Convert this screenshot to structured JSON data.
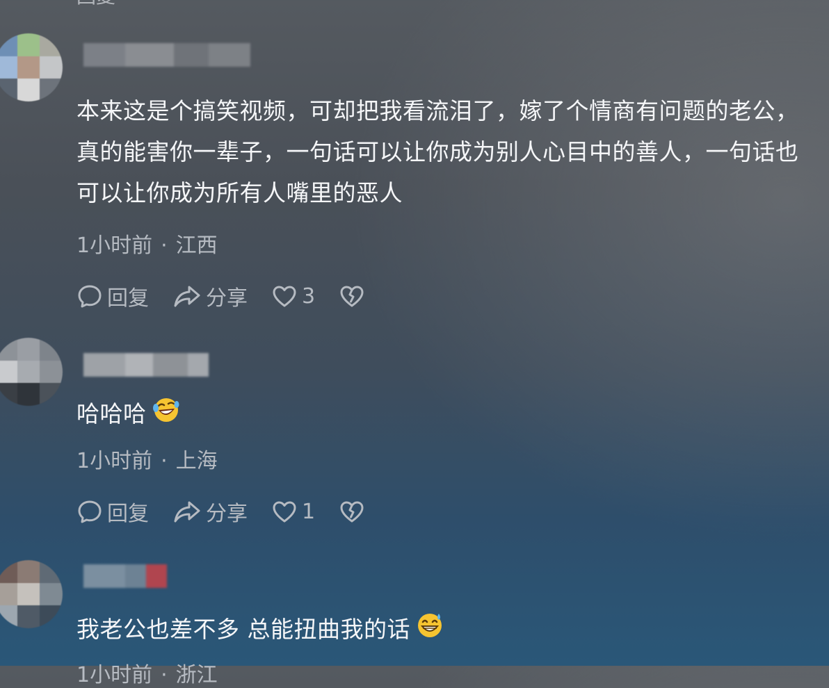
{
  "top_partial": "回复",
  "comments": [
    {
      "text": "本来这是个搞笑视频，可却把我看流泪了，嫁了个情商有问题的老公，真的能害你一辈子，一句话可以让你成为别人心目中的善人，一句话也可以让你成为所有人嘴里的恶人",
      "time": "1小时前",
      "sep": "·",
      "location": "江西",
      "reply_label": "回复",
      "share_label": "分享",
      "likes": "3"
    },
    {
      "text": "哈哈哈",
      "emoji": "rolling-laughing-emoji",
      "time": "1小时前",
      "sep": "·",
      "location": "上海",
      "reply_label": "回复",
      "share_label": "分享",
      "likes": "1"
    },
    {
      "text": "我老公也差不多 总能扭曲我的话",
      "emoji": "grinning-sweat-emoji",
      "time": "1小时前",
      "sep": "·",
      "location": "浙江"
    }
  ],
  "icons": {
    "reply": "comment-bubble-icon",
    "share": "share-arrow-icon",
    "like": "heart-icon",
    "dislike": "broken-heart-icon"
  },
  "colors": {
    "text": "#f5f6f8",
    "meta": "#b6bbc2"
  }
}
